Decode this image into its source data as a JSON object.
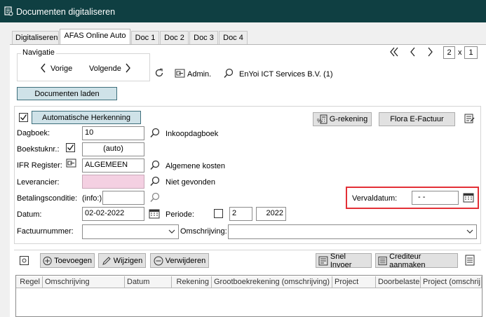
{
  "window": {
    "title": "Documenten digitaliseren"
  },
  "tabs": [
    {
      "label": "Digitaliseren",
      "active": false
    },
    {
      "label": "AFAS Online Auto",
      "active": true
    },
    {
      "label": "Doc 1",
      "active": false
    },
    {
      "label": "Doc 2",
      "active": false
    },
    {
      "label": "Doc 3",
      "active": false
    },
    {
      "label": "Doc 4",
      "active": false
    }
  ],
  "navigation": {
    "legend": "Navigatie",
    "prev_label": "Vorige",
    "next_label": "Volgende",
    "admin_label": "Admin.",
    "company": "EnYoi ICT Services B.V. (1)",
    "page_current": "2",
    "page_sep": "x",
    "page_total": "1"
  },
  "load_button": "Documenten laden",
  "recognition": {
    "auto_label": "Automatische Herkenning",
    "auto_checked": true,
    "g_rekening": "G-rekening",
    "flora": "Flora E-Factuur"
  },
  "form": {
    "dagboek_label": "Dagboek:",
    "dagboek_value": "10",
    "dagboek_desc": "Inkoopdagboek",
    "boekstuk_label": "Boekstuknr.:",
    "boekstuk_checked": true,
    "boekstuk_value": "(auto)",
    "ifr_label": "IFR Register:",
    "ifr_value": "ALGEMEEN",
    "ifr_desc": "Algemene kosten",
    "leverancier_label": "Leverancier:",
    "leverancier_value": "",
    "leverancier_desc": "Niet gevonden",
    "betaling_label": "Betalingsconditie:",
    "betaling_prefix": "(info:)",
    "betaling_value": "",
    "datum_label": "Datum:",
    "datum_value": "02-02-2022",
    "periode_label": "Periode:",
    "periode_checked": false,
    "periode_value": "2",
    "jaar_value": "2022",
    "factuur_label": "Factuurnummer:",
    "factuur_value": "",
    "omschrijving_label": "Omschrijving:",
    "omschrijving_value": "",
    "vervaldatum_label": "Vervaldatum:",
    "vervaldatum_value": "-  -"
  },
  "toolbar": {
    "add": "Toevoegen",
    "edit": "Wijzigen",
    "delete": "Verwijderen",
    "quick": "Snel Invoer",
    "creditor": "Crediteur aanmaken"
  },
  "grid": {
    "columns": [
      "Regel",
      "Omschrijving",
      "Datum",
      "Rekening",
      "Grootboekrekening (omschrijving)",
      "Project",
      "Doorbelaste",
      "Project (omschrij"
    ]
  },
  "colors": {
    "titlebar": "#0f3f42",
    "highlight": "#e33036",
    "leverancier_bg": "#f4d0e2"
  }
}
